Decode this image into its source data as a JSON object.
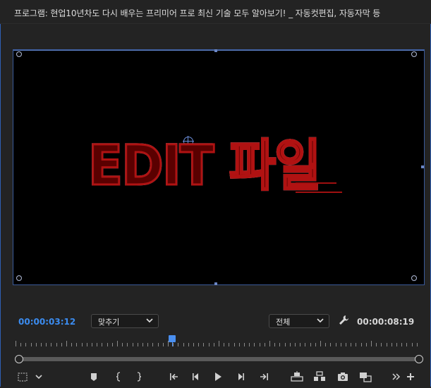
{
  "title": "프로그램: 현업10년차도 다시 배우는 프리미어 프로 최신 기술 모두 알아보기! _ 자동컷편집, 자동자막 등",
  "viewer": {
    "overlay_text_part1": "EDIT",
    "overlay_text_part2": "파일"
  },
  "controls": {
    "current_timecode": "00:00:03:12",
    "zoom_dropdown": "맞추기",
    "quality_dropdown": "전체",
    "duration_timecode": "00:00:08:19"
  },
  "toolbar": {
    "icons": [
      "safe-margins-icon",
      "settings-chevron-icon",
      "add-marker-icon",
      "mark-in-icon",
      "mark-out-icon",
      "go-to-in-icon",
      "step-back-icon",
      "play-icon",
      "step-forward-icon",
      "go-to-out-icon",
      "lift-icon",
      "extract-icon",
      "export-frame-icon",
      "comparison-view-icon",
      "more-controls-icon",
      "button-editor-icon"
    ]
  },
  "colors": {
    "accent_blue": "#3b8cf0",
    "panel_bg": "#232323",
    "frame_border": "#3a5a9a"
  }
}
